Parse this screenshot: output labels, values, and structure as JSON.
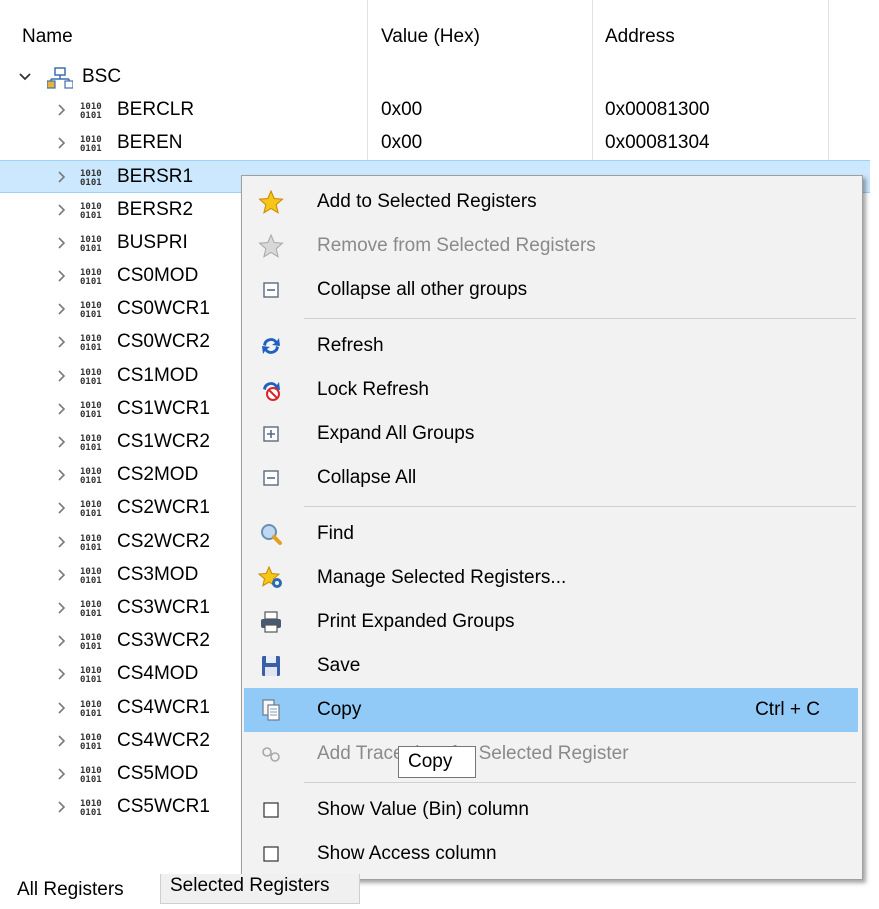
{
  "columns": {
    "name": "Name",
    "value": "Value (Hex)",
    "address": "Address"
  },
  "group": {
    "label": "BSC"
  },
  "registers": [
    {
      "name": "BERCLR",
      "value": "0x00",
      "address": "0x00081300"
    },
    {
      "name": "BEREN",
      "value": "0x00",
      "address": "0x00081304"
    },
    {
      "name": "BERSR1",
      "value": "",
      "address": ""
    },
    {
      "name": "BERSR2",
      "value": "",
      "address": ""
    },
    {
      "name": "BUSPRI",
      "value": "",
      "address": ""
    },
    {
      "name": "CS0MOD",
      "value": "",
      "address": ""
    },
    {
      "name": "CS0WCR1",
      "value": "",
      "address": ""
    },
    {
      "name": "CS0WCR2",
      "value": "",
      "address": ""
    },
    {
      "name": "CS1MOD",
      "value": "",
      "address": ""
    },
    {
      "name": "CS1WCR1",
      "value": "",
      "address": ""
    },
    {
      "name": "CS1WCR2",
      "value": "",
      "address": ""
    },
    {
      "name": "CS2MOD",
      "value": "",
      "address": ""
    },
    {
      "name": "CS2WCR1",
      "value": "",
      "address": ""
    },
    {
      "name": "CS2WCR2",
      "value": "",
      "address": ""
    },
    {
      "name": "CS3MOD",
      "value": "",
      "address": ""
    },
    {
      "name": "CS3WCR1",
      "value": "",
      "address": ""
    },
    {
      "name": "CS3WCR2",
      "value": "",
      "address": ""
    },
    {
      "name": "CS4MOD",
      "value": "",
      "address": ""
    },
    {
      "name": "CS4WCR1",
      "value": "",
      "address": ""
    },
    {
      "name": "CS4WCR2",
      "value": "",
      "address": ""
    },
    {
      "name": "CS5MOD",
      "value": "",
      "address": ""
    },
    {
      "name": "CS5WCR1",
      "value": "",
      "address": ""
    }
  ],
  "menu": {
    "add_selected": "Add to Selected Registers",
    "remove_selected": "Remove from Selected Registers",
    "collapse_other": "Collapse all other groups",
    "refresh": "Refresh",
    "lock_refresh": "Lock Refresh",
    "expand_all": "Expand All Groups",
    "collapse_all": "Collapse All",
    "find": "Find",
    "manage_selected": "Manage Selected Registers...",
    "print_expanded": "Print Expanded Groups",
    "save": "Save",
    "copy": "Copy",
    "copy_shortcut": "Ctrl + C",
    "add_trace": "Add Trace data for Selected Register",
    "show_bin": "Show Value (Bin) column",
    "show_access": "Show Access column"
  },
  "tooltip": "Copy",
  "tabs": {
    "all": "All Registers",
    "selected": "Selected Registers"
  },
  "colors": {
    "selection": "#cce8ff",
    "menu_highlight": "#91c9f7",
    "menu_bg": "#f2f2f2"
  }
}
